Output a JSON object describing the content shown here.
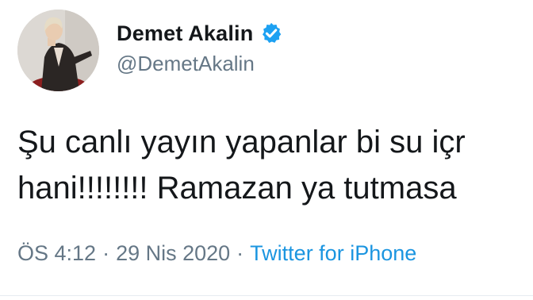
{
  "author": {
    "display_name": "Demet Akalin",
    "handle": "@DemetAkalin",
    "verified": true,
    "avatar_icon": "profile-photo"
  },
  "tweet": {
    "lines": [
      "Şu canlı yayın yapanlar bi su içr",
      "hani!!!!!!!! Ramazan ya tutmasa"
    ]
  },
  "meta": {
    "time": "ÖS 4:12",
    "separator_1": "·",
    "date": "29 Nis 2020",
    "separator_2": "·",
    "source": "Twitter for iPhone"
  },
  "colors": {
    "text": "#14171a",
    "secondary": "#657786",
    "link": "#1b95e0",
    "verified_badge": "#1da1f2"
  }
}
